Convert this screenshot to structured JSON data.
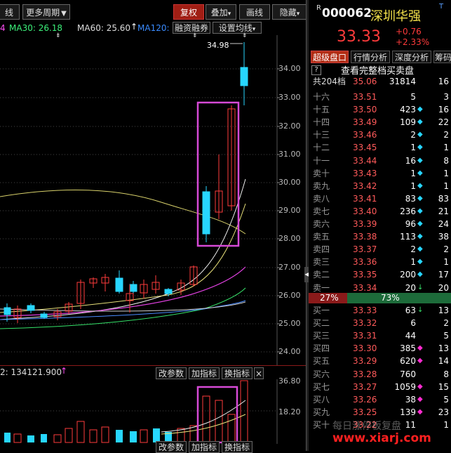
{
  "toolbar": {
    "left_partial": "线",
    "period_button": "更多周期",
    "restore_button": "复权",
    "overlay_button": "叠加",
    "draw_button": "画线",
    "hide_button": "隐藏"
  },
  "indicators": {
    "ma_partial": "4",
    "ma30": "MA30: 26.18",
    "ma60": "MA60: 25.60",
    "ma120": "MA120: 2",
    "margin_button": "融资融券",
    "settings_button": "设置均线"
  },
  "price_axis": [
    "34.00",
    "33.00",
    "32.00",
    "31.00",
    "30.00",
    "29.00",
    "28.00",
    "27.00",
    "26.00",
    "25.00",
    "24.00"
  ],
  "high_label": "34.98",
  "volume_panel": {
    "label": "2: 134121.900",
    "modify_button": "改参数",
    "add_button": "加指标",
    "swap_button": "换指标",
    "close_symbol": "×",
    "axis_top": "36.80",
    "axis_mid": "18.20"
  },
  "bottom_bar": {
    "modify_button": "改参数",
    "add_button": "加指标",
    "swap_button": "换指标"
  },
  "stock": {
    "code_prefix": "R",
    "code": "000062",
    "name": "深圳华强",
    "price": "33.33",
    "change": "+0.76",
    "change_pct": "+2.33%"
  },
  "tabs": [
    "超级盘口",
    "行情分析",
    "深度分析",
    "筹码"
  ],
  "orderbook_header": {
    "question": "?",
    "link": "查看完整档买卖盘",
    "total_label": "共204档",
    "total_price": "35.06",
    "total_volume": "31814",
    "total_count": "16"
  },
  "sell_rows": [
    {
      "level": "十六",
      "price": "33.51",
      "vol": "5",
      "mark": "",
      "count": "3"
    },
    {
      "level": "十五",
      "price": "33.50",
      "vol": "423",
      "mark": "◆",
      "count": "16"
    },
    {
      "level": "十四",
      "price": "33.49",
      "vol": "109",
      "mark": "◆",
      "count": "22"
    },
    {
      "level": "十三",
      "price": "33.46",
      "vol": "2",
      "mark": "◆",
      "count": "2"
    },
    {
      "level": "十二",
      "price": "33.45",
      "vol": "1",
      "mark": "◆",
      "count": "1"
    },
    {
      "level": "十一",
      "price": "33.44",
      "vol": "16",
      "mark": "◆",
      "count": "8"
    },
    {
      "level": "卖十",
      "price": "33.43",
      "vol": "1",
      "mark": "◆",
      "count": "1"
    },
    {
      "level": "卖九",
      "price": "33.42",
      "vol": "1",
      "mark": "◆",
      "count": "1"
    },
    {
      "level": "卖八",
      "price": "33.41",
      "vol": "83",
      "mark": "◆",
      "count": "83"
    },
    {
      "level": "卖七",
      "price": "33.40",
      "vol": "236",
      "mark": "◆",
      "count": "21"
    },
    {
      "level": "卖六",
      "price": "33.39",
      "vol": "96",
      "mark": "◆",
      "count": "24"
    },
    {
      "level": "卖五",
      "price": "33.38",
      "vol": "113",
      "mark": "◆",
      "count": "38"
    },
    {
      "level": "卖四",
      "price": "33.37",
      "vol": "2",
      "mark": "◆",
      "count": "2"
    },
    {
      "level": "卖三",
      "price": "33.36",
      "vol": "1",
      "mark": "◆",
      "count": "1"
    },
    {
      "level": "卖二",
      "price": "33.35",
      "vol": "200",
      "mark": "◆",
      "count": "17"
    },
    {
      "level": "卖一",
      "price": "33.34",
      "vol": "20",
      "mark": "↓",
      "count": "20"
    }
  ],
  "ratio": {
    "left": "27%",
    "right": "73%"
  },
  "buy_rows": [
    {
      "level": "买一",
      "price": "33.33",
      "vol": "63",
      "mark": "↓",
      "count": "13"
    },
    {
      "level": "买二",
      "price": "33.32",
      "vol": "6",
      "mark": "",
      "count": "2"
    },
    {
      "level": "买三",
      "price": "33.31",
      "vol": "44",
      "mark": "",
      "count": "5"
    },
    {
      "level": "买四",
      "price": "33.30",
      "vol": "385",
      "mark": "◆",
      "count": "13"
    },
    {
      "level": "买五",
      "price": "33.29",
      "vol": "620",
      "mark": "◆",
      "count": "14"
    },
    {
      "level": "买六",
      "price": "33.28",
      "vol": "760",
      "mark": "",
      "count": "8"
    },
    {
      "level": "买七",
      "price": "33.27",
      "vol": "1059",
      "mark": "◆",
      "count": "15"
    },
    {
      "level": "买八",
      "price": "33.26",
      "vol": "38",
      "mark": "◆",
      "count": "5"
    },
    {
      "level": "买九",
      "price": "33.25",
      "vol": "139",
      "mark": "◆",
      "count": "23"
    },
    {
      "level": "买十",
      "price": "33.22",
      "vol": "11",
      "mark": "",
      "count": "1"
    }
  ],
  "watermark": {
    "text": "每日涨停板复盘",
    "url": "www.xiarj.com"
  },
  "colors": {
    "up": "#ff3b3b",
    "down": "#00e5ff",
    "highlight_box": "#d64ad6",
    "cyan_mark": "#27d6ff",
    "magenta_mark": "#ff2bd1"
  }
}
